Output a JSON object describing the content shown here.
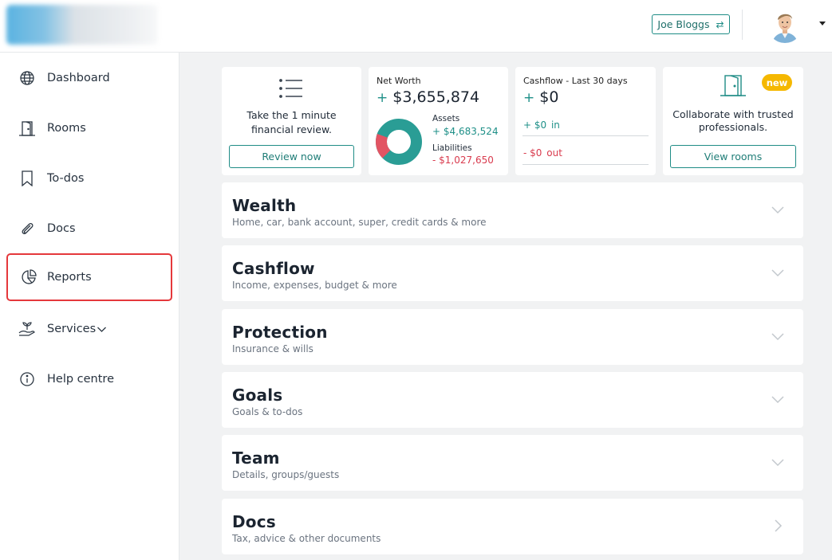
{
  "header": {
    "user_name": "Joe Bloggs",
    "switch_icon": "swap-icon"
  },
  "sidebar": {
    "items": [
      {
        "label": "Dashboard",
        "icon": "globe-icon"
      },
      {
        "label": "Rooms",
        "icon": "door-icon"
      },
      {
        "label": "To-dos",
        "icon": "bookmark-icon"
      },
      {
        "label": "Docs",
        "icon": "paperclip-icon"
      },
      {
        "label": "Reports",
        "icon": "pie-chart-icon"
      },
      {
        "label": "Services",
        "icon": "hand-plant-icon"
      },
      {
        "label": "Help centre",
        "icon": "info-icon"
      }
    ]
  },
  "cards": {
    "review": {
      "text": "Take the 1 minute financial review.",
      "button": "Review now"
    },
    "networth": {
      "title": "Net Worth",
      "sign": "+",
      "value": "$3,655,874",
      "assets_label": "Assets",
      "assets_value": "+ $4,683,524",
      "liabilities_label": "Liabilities",
      "liabilities_value": "- $1,027,650",
      "assets_color": "#2a9d95",
      "liabilities_color": "#e25463"
    },
    "cashflow": {
      "title": "Cashflow - Last 30 days",
      "sign": "+",
      "value": "$0",
      "in_amount": "+ $0",
      "in_word": "in",
      "out_amount": "- $0",
      "out_word": "out"
    },
    "rooms": {
      "badge": "new",
      "text": "Collaborate with trusted professionals.",
      "button": "View rooms"
    }
  },
  "sections": [
    {
      "title": "Wealth",
      "subtitle": "Home, car, bank account, super, credit cards & more"
    },
    {
      "title": "Cashflow",
      "subtitle": "Income, expenses, budget & more"
    },
    {
      "title": "Protection",
      "subtitle": "Insurance & wills"
    },
    {
      "title": "Goals",
      "subtitle": "Goals & to-dos"
    },
    {
      "title": "Team",
      "subtitle": "Details, groups/guests"
    },
    {
      "title": "Docs",
      "subtitle": "Tax, advice & other documents"
    }
  ],
  "colors": {
    "accent": "#1f8c86",
    "highlight_border": "#e5383b",
    "badge": "#f5b800"
  }
}
